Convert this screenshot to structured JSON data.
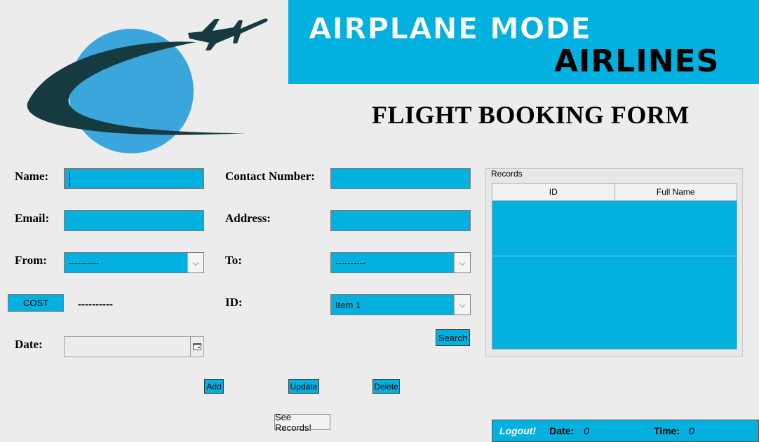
{
  "brand": {
    "line1": "AIRPLANE MODE",
    "line2": "AIRLINES"
  },
  "form_title": "FLIGHT BOOKING FORM",
  "labels": {
    "name": "Name:",
    "email": "Email:",
    "from": "From:",
    "date": "Date:",
    "contact": "Contact Number:",
    "address": "Address:",
    "to": "To:",
    "id": "ID:"
  },
  "fields": {
    "name": "",
    "email": "",
    "contact": "",
    "address": "",
    "date": "",
    "from_selected": "----------",
    "to_selected": "----------",
    "id_selected": "Item 1"
  },
  "cost": {
    "button": "COST",
    "value": "----------"
  },
  "buttons": {
    "search": "Search",
    "add": "Add",
    "update": "Update",
    "delete": "Delete",
    "see_records": "See Records!"
  },
  "records": {
    "title": "Records",
    "columns": [
      "ID",
      "Full Name"
    ]
  },
  "status": {
    "logout": "Logout!",
    "date_label": "Date:",
    "date_value": "0",
    "time_label": "Time:",
    "time_value": "0"
  },
  "colors": {
    "accent": "#02b1e0",
    "globe": "#3aa6dc",
    "swoosh": "#153a40",
    "background": "#ececec"
  },
  "icons": {
    "logo": "globe-airplane-logo",
    "calendar": "calendar-icon",
    "dropdown": "chevron-down-icon"
  }
}
